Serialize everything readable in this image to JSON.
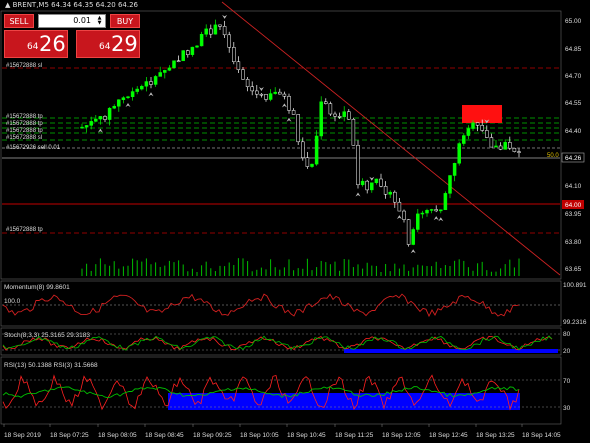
{
  "header": {
    "title_text": "▲ BRENT,M5  64.34 64.35 64.20 64.26"
  },
  "trade_panel": {
    "sell_label": "SELL",
    "buy_label": "BUY",
    "lot_value": "0.01",
    "sell_prefix": "64",
    "sell_big": "26",
    "buy_prefix": "64",
    "buy_big": "29"
  },
  "price_axis": {
    "labels": [
      "65.00",
      "64.85",
      "64.70",
      "64.55",
      "64.40",
      "64.26",
      "64.10",
      "64.00",
      "63.95",
      "63.80",
      "63.65"
    ],
    "current_price": "64.26",
    "red_tag": "64.00",
    "fifty_label": "50.0"
  },
  "order_labels": [
    "#15672888 sl",
    "#15672888 tp",
    "#15672888 tp",
    "#15672888 tp",
    "#15672888 sl",
    "#15672926 sell 0.01",
    "#15672888 tp"
  ],
  "momentum": {
    "title": "Momentum(8) 99.8601",
    "level_label": "100.0",
    "axis_labels": [
      "100.891",
      "99.2316"
    ]
  },
  "stoch": {
    "title": "Stoch(8,3,3) 25.3165 29.3183",
    "axis_labels": [
      "80",
      "20"
    ]
  },
  "rsi": {
    "title": "RSI(13) 50.1388  RSI(3) 31.5668",
    "axis_labels": [
      "70",
      "30"
    ]
  },
  "time_axis": {
    "labels": [
      "18 Sep 2019",
      "18 Sep 07:25",
      "18 Sep 08:05",
      "18 Sep 08:45",
      "18 Sep 09:25",
      "18 Sep 10:05",
      "18 Sep 10:45",
      "18 Sep 11:25",
      "18 Sep 12:05",
      "18 Sep 12:45",
      "18 Sep 13:25",
      "18 Sep 14:05"
    ]
  },
  "colors": {
    "background": "#000000",
    "bull_candle": "#00ff00",
    "bear_candle": "#ffffff",
    "order_line": "#b0b0b0",
    "tp_line": "#00c000",
    "sl_line": "#c00000",
    "trend_line": "#cc2222",
    "stoch_main": "#00c000",
    "stoch_signal": "#ff2222",
    "rsi_fill": "#0000ff",
    "button_red": "#c8161d"
  }
}
